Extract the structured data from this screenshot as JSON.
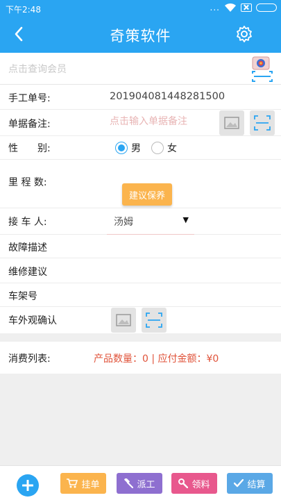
{
  "status_bar": {
    "time": "下午2:48",
    "dots": "..."
  },
  "header": {
    "title": "奇策软件",
    "back_icon": "chevron-left-icon",
    "settings_icon": "gear-icon"
  },
  "search": {
    "placeholder": "点击查询会员",
    "camera_icon": "scan-camera-icon"
  },
  "form": {
    "order_no": {
      "label": "手工单号:",
      "value": "201904081448281500"
    },
    "remark": {
      "label": "单据备注:",
      "placeholder": "点击输入单据备注"
    },
    "gender": {
      "label": "性　　别:",
      "options": [
        "男",
        "女"
      ],
      "selected": "男"
    },
    "mileage": {
      "label": "里 程 数:",
      "suggest_button": "建议保养"
    },
    "receiver": {
      "label": "接 车 人:",
      "value": "汤姆"
    },
    "fault": {
      "label": "故障描述"
    },
    "advice": {
      "label": "维修建议"
    },
    "vin": {
      "label": "车架号"
    },
    "appearance": {
      "label": "车外观确认"
    }
  },
  "consumption": {
    "label": "消费列表:",
    "summary": "产品数量：0 | 应付金额：¥0"
  },
  "bottom": {
    "hold": "挂单",
    "dispatch": "派工",
    "pick": "领料",
    "checkout": "结算"
  },
  "colors": {
    "primary": "#2aa5f2",
    "orange": "#fbb44d",
    "purple": "#8e6fd0",
    "pink": "#e8588d",
    "blue_btn": "#5aa8e6",
    "summary_red": "#e0533a"
  }
}
